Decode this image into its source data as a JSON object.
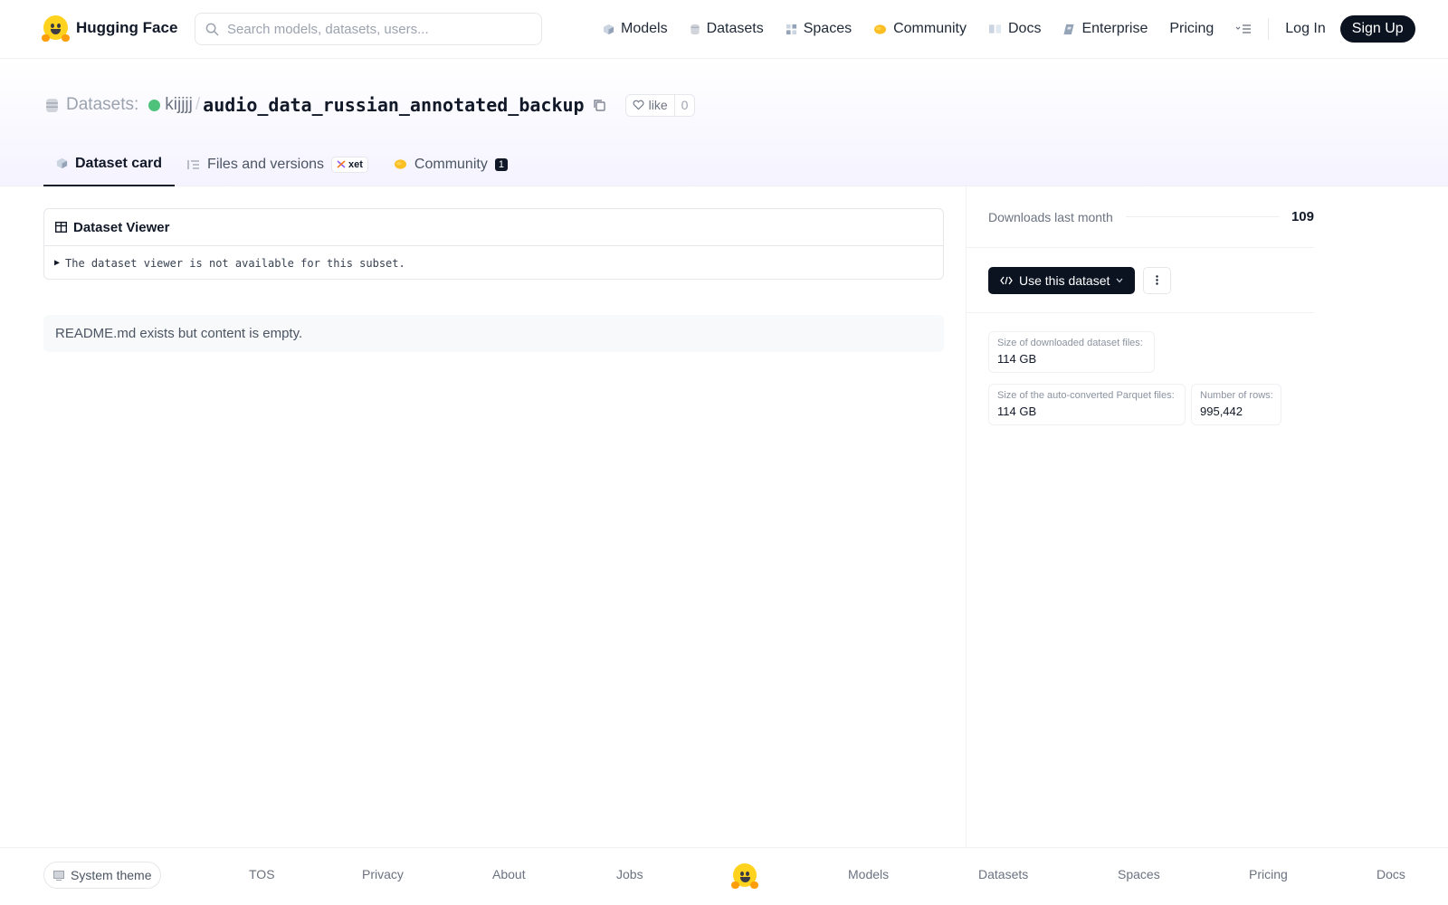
{
  "header": {
    "brand": "Hugging Face",
    "search_placeholder": "Search models, datasets, users...",
    "nav": [
      {
        "label": "Models",
        "icon": "cube-icon"
      },
      {
        "label": "Datasets",
        "icon": "database-icon"
      },
      {
        "label": "Spaces",
        "icon": "grid-icon"
      },
      {
        "label": "Community",
        "icon": "community-icon"
      },
      {
        "label": "Docs",
        "icon": "book-icon"
      },
      {
        "label": "Enterprise",
        "icon": "enterprise-icon"
      },
      {
        "label": "Pricing"
      }
    ],
    "login": "Log In",
    "signup": "Sign Up"
  },
  "repo": {
    "type_label": "Datasets:",
    "owner": "kijjjj",
    "separator": "/",
    "name": "audio_data_russian_annotated_backup",
    "like_label": "like",
    "like_count": "0"
  },
  "tabs": [
    {
      "label": "Dataset card",
      "active": true
    },
    {
      "label": "Files and versions",
      "badge": "xet"
    },
    {
      "label": "Community",
      "count": "1"
    }
  ],
  "main": {
    "viewer_title": "Dataset Viewer",
    "viewer_message": "The dataset viewer is not available for this subset.",
    "readme_message": "README.md exists but content is empty."
  },
  "sidebar": {
    "downloads_label": "Downloads last month",
    "downloads_value": "109",
    "use_button": "Use this dataset",
    "stats": [
      {
        "label": "Size of downloaded dataset files:",
        "value": "114 GB"
      },
      {
        "label": "Size of the auto-converted Parquet files:",
        "value": "114 GB"
      },
      {
        "label": "Number of rows:",
        "value": "995,442"
      }
    ]
  },
  "footer": {
    "theme": "System theme",
    "links": [
      "TOS",
      "Privacy",
      "About",
      "Jobs",
      "Models",
      "Datasets",
      "Spaces",
      "Pricing",
      "Docs"
    ]
  },
  "colors": {
    "accent_dark": "#0b1220",
    "status_green": "#4ec27a",
    "brand_yellow": "#ffd21e"
  }
}
